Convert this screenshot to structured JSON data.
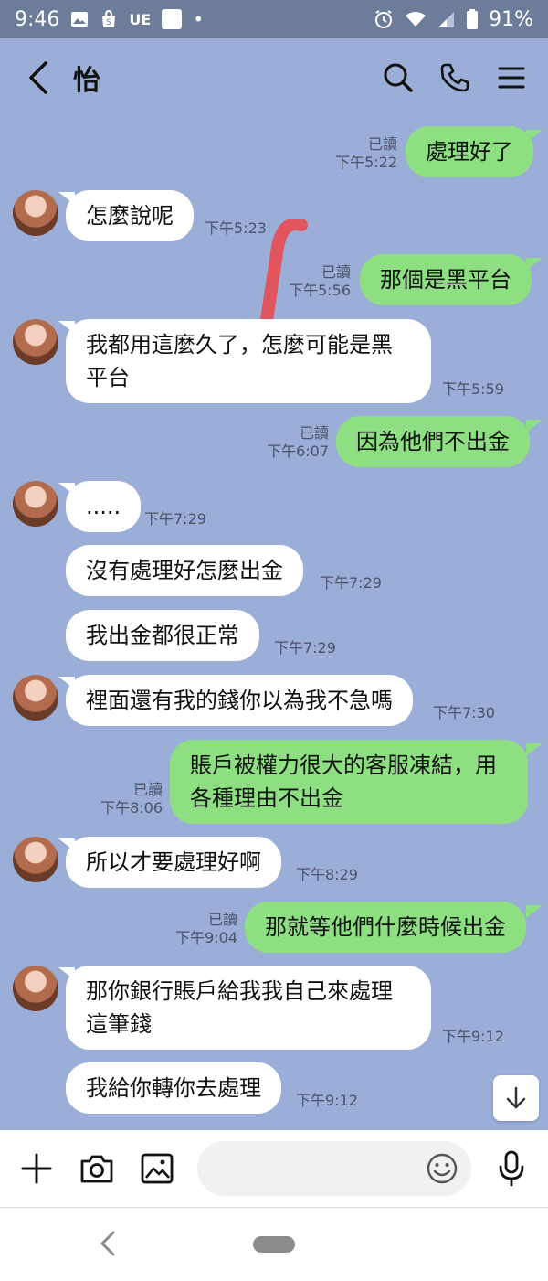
{
  "status_bar": {
    "time": "9:46",
    "left_icons": [
      "image-icon",
      "shopee-icon",
      "ue-label",
      "app-square-icon",
      "dot-icon"
    ],
    "ue_label": "UE",
    "dot": "•",
    "battery": "91%"
  },
  "header": {
    "title": "怡"
  },
  "messages": [
    {
      "side": "out",
      "text": "處理好了",
      "read": "已讀",
      "time": "下午5:22"
    },
    {
      "side": "in",
      "text": "怎麼說呢",
      "time": "下午5:23",
      "avatar": true
    },
    {
      "side": "out",
      "text": "那個是黑平台",
      "read": "已讀",
      "time": "下午5:56"
    },
    {
      "side": "in",
      "text": "我都用這麼久了，怎麼可能是黑平台",
      "time": "下午5:59",
      "avatar": true
    },
    {
      "side": "out",
      "text": "因為他們不出金",
      "read": "已讀",
      "time": "下午6:07"
    },
    {
      "side": "in",
      "text": ".....",
      "time": "下午7:29",
      "avatar": true
    },
    {
      "side": "in",
      "text": "沒有處理好怎麼出金",
      "time": "下午7:29"
    },
    {
      "side": "in",
      "text": "我出金都很正常",
      "time": "下午7:29"
    },
    {
      "side": "in",
      "text": "裡面還有我的錢你以為我不急嗎",
      "time": "下午7:30",
      "avatar": true
    },
    {
      "side": "out",
      "text": "賬戶被權力很大的客服凍結，用各種理由不出金",
      "read": "已讀",
      "time": "下午8:06"
    },
    {
      "side": "in",
      "text": "所以才要處理好啊",
      "time": "下午8:29",
      "avatar": true
    },
    {
      "side": "out",
      "text": "那就等他們什麼時候出金",
      "read": "已讀",
      "time": "下午9:04"
    },
    {
      "side": "in",
      "text": "那你銀行賬戶給我我自己來處理這筆錢",
      "time": "下午9:12",
      "avatar": true
    },
    {
      "side": "in",
      "text": "我給你轉你去處理",
      "time": "下午9:12"
    }
  ],
  "input": {
    "placeholder": ""
  },
  "colors": {
    "background": "#9aaed8",
    "outgoing_bubble": "#8ddf82",
    "incoming_bubble": "#ffffff",
    "status_bar": "#6d7c99",
    "scribble": "#e0555e"
  }
}
